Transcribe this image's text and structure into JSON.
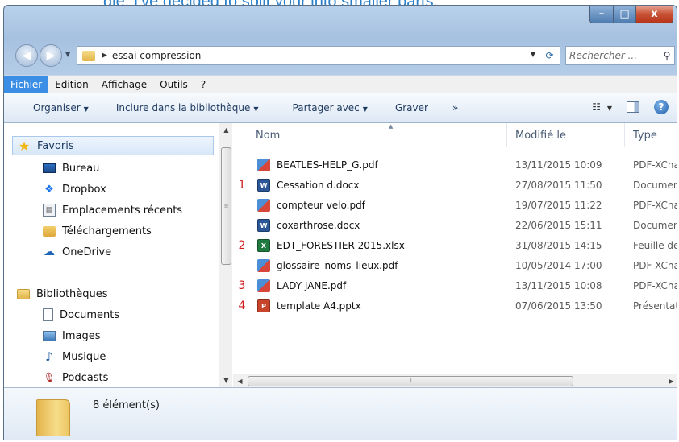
{
  "top_text": "gle, I've decided to split your into smaller parts.",
  "window": {
    "caption": {
      "min": "–",
      "max": "□",
      "close": "x"
    }
  },
  "address": {
    "path": "essai compression",
    "search_placeholder": "Rechercher ..."
  },
  "menu": [
    "Fichier",
    "Edition",
    "Affichage",
    "Outils",
    "?"
  ],
  "toolbar": {
    "organiser": "Organiser",
    "inclure": "Inclure dans la bibliothèque",
    "partager": "Partager avec",
    "graver": "Graver",
    "more": "»"
  },
  "nav": {
    "favoris": "Favoris",
    "favorites": [
      "Bureau",
      "Dropbox",
      "Emplacements récents",
      "Téléchargements",
      "OneDrive"
    ],
    "bibliotheques": "Bibliothèques",
    "libraries": [
      "Documents",
      "Images",
      "Musique",
      "Podcasts"
    ]
  },
  "columns": {
    "name": "Nom",
    "modified": "Modifié le",
    "type": "Type"
  },
  "files": [
    {
      "num": "",
      "name": "BEATLES-HELP_G.pdf",
      "date": "13/11/2015 10:09",
      "type": "PDF-XCha",
      "icon": "pdf-icon"
    },
    {
      "num": "1",
      "name": "Cessation d.docx",
      "date": "27/08/2015 11:50",
      "type": "Documen",
      "icon": "word-icon"
    },
    {
      "num": "",
      "name": "compteur velo.pdf",
      "date": "19/07/2015 11:22",
      "type": "PDF-XCha",
      "icon": "pdf-icon"
    },
    {
      "num": "",
      "name": "coxarthrose.docx",
      "date": "22/06/2015 15:11",
      "type": "Documen",
      "icon": "word-icon"
    },
    {
      "num": "2",
      "name": "EDT_FORESTIER-2015.xlsx",
      "date": "31/08/2015 14:15",
      "type": "Feuille de",
      "icon": "excel-icon"
    },
    {
      "num": "",
      "name": "glossaire_noms_lieux.pdf",
      "date": "10/05/2014 17:00",
      "type": "PDF-XCha",
      "icon": "pdf-icon"
    },
    {
      "num": "3",
      "name": "LADY JANE.pdf",
      "date": "13/11/2015 10:08",
      "type": "PDF-XCha",
      "icon": "pdf-icon"
    },
    {
      "num": "4",
      "name": "template A4.pptx",
      "date": "07/06/2015 13:50",
      "type": "Présentat",
      "icon": "ppt-icon"
    }
  ],
  "status": {
    "count": "8 élément(s)"
  }
}
